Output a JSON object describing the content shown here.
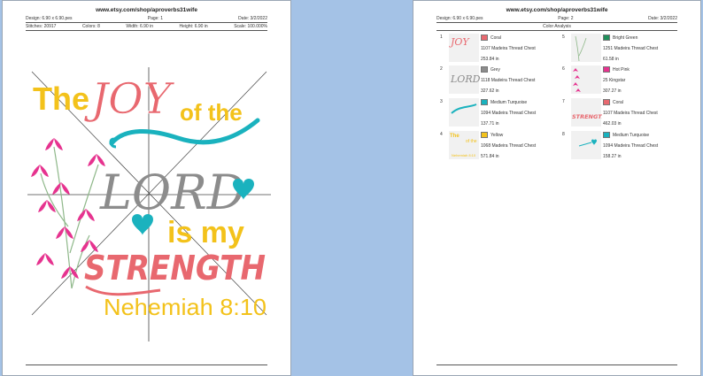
{
  "colors": {
    "coral": "#e8686f",
    "grey": "#8c8c8c",
    "turquoise": "#1ab2be",
    "yellow": "#f3c21b",
    "bright_green": "#1f8f5a",
    "hot_pink": "#e6338f",
    "vine_green": "#8fb88a"
  },
  "page1": {
    "site": "www.etsy.com/shop/aproverbs31wife",
    "design_label": "Design: 6.90 x 6.90.pes",
    "page_label": "Page: 1",
    "date_label": "Date: 3/2/2022",
    "stitches_label": "Stitches: 20917",
    "colors_label": "Colors: 8",
    "width_label": "Width: 6.90 in",
    "height_label": "Height: 6.90 in",
    "scale_label": "Scale: 100.000%",
    "design_text": {
      "the": "The",
      "joy": "JOY",
      "of_the": "of the",
      "lord": "LORD",
      "is_my": "is my",
      "strength": "STRENGTH",
      "reference": "Nehemiah 8:10"
    }
  },
  "page2": {
    "site": "www.etsy.com/shop/aproverbs31wife",
    "design_label": "Design: 6.90 x 6.90.pes",
    "page_label": "Page: 2",
    "date_label": "Date: 3/2/2022",
    "section_label": "Color Analysis",
    "entries": [
      {
        "num": "1",
        "name": "Coral",
        "thread": "1107 Madeira Thread Chest",
        "length": "253.84 in",
        "color": "#e8686f",
        "thumb": "joy"
      },
      {
        "num": "2",
        "name": "Grey",
        "thread": "1118 Madeira Thread Chest",
        "length": "327.62 in",
        "color": "#8c8c8c",
        "thumb": "lord"
      },
      {
        "num": "3",
        "name": "Medium Turquoise",
        "thread": "1094 Madeira Thread Chest",
        "length": "137.71 in",
        "color": "#1ab2be",
        "thumb": "swirl"
      },
      {
        "num": "4",
        "name": "Yellow",
        "thread": "1068 Madeira Thread Chest",
        "length": "571.84 in",
        "color": "#f3c21b",
        "thumb": "yellow"
      },
      {
        "num": "5",
        "name": "Bright Green",
        "thread": "1251 Madeira Thread Chest",
        "length": "61.58 in",
        "color": "#1f8f5a",
        "thumb": "vines"
      },
      {
        "num": "6",
        "name": "Hot Pink",
        "thread": "25 Kingstar",
        "length": "307.27 in",
        "color": "#e6338f",
        "thumb": "leaves"
      },
      {
        "num": "7",
        "name": "Coral",
        "thread": "1107 Madeira Thread Chest",
        "length": "462.03 in",
        "color": "#e8686f",
        "thumb": "strength"
      },
      {
        "num": "8",
        "name": "Medium Turquoise",
        "thread": "1094 Madeira Thread Chest",
        "length": "158.27 in",
        "color": "#1ab2be",
        "thumb": "hearts"
      }
    ]
  }
}
